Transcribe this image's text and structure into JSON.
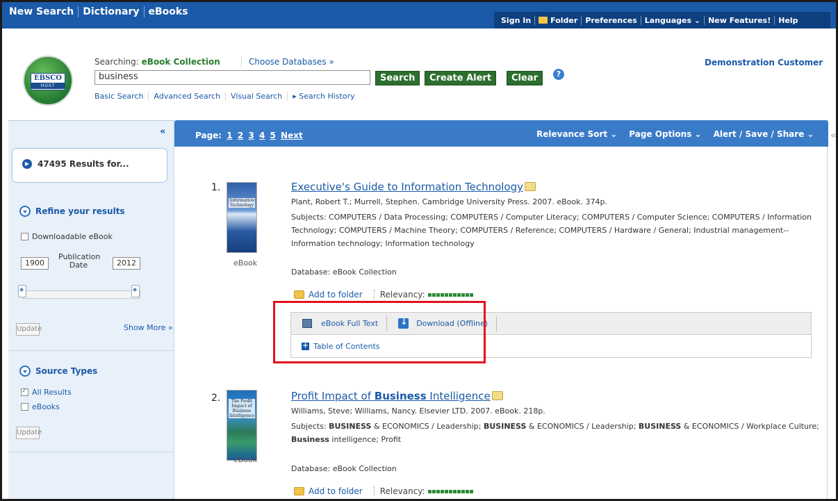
{
  "topnav": {
    "items": [
      "New Search",
      "Dictionary",
      "eBooks"
    ]
  },
  "rightnav": {
    "items": [
      "Sign In",
      "Folder",
      "Preferences",
      "Languages ⌄",
      "New Features!",
      "Help"
    ]
  },
  "search": {
    "searching_label": "Searching:",
    "collection": "eBook Collection",
    "choose_databases": "Choose Databases »",
    "query": "business",
    "buttons": {
      "search": "Search",
      "create_alert": "Create Alert",
      "clear": "Clear"
    },
    "links": [
      "Basic Search",
      "Advanced Search",
      "Visual Search",
      "▸ Search History"
    ]
  },
  "logo": {
    "line1": "EBSCO",
    "line2": "HOST"
  },
  "customer": "Demonstration Customer",
  "sidebar": {
    "collapse": "«",
    "results_count": "47495 Results for...",
    "refine_title": "Refine your results",
    "downloadable": "Downloadable eBook",
    "year_from": "1900",
    "year_to": "2012",
    "pub_date_label": "Publication Date",
    "update": "Update",
    "show_more": "Show More »",
    "source_types_title": "Source Types",
    "source_all": "All Results",
    "source_ebooks": "eBooks",
    "update2": "Update"
  },
  "toolbar": {
    "page_label": "Page:",
    "pages": [
      "1",
      "2",
      "3",
      "4",
      "5",
      "Next"
    ],
    "relevance": "Relevance Sort ⌄",
    "page_options": "Page Options ⌄",
    "alert_share": "Alert / Save / Share ⌄",
    "collapse_right": "«"
  },
  "results": [
    {
      "num": "1.",
      "cover_title": "Information Technology",
      "cover_label": "eBook",
      "title": "Executive's Guide to Information Technology",
      "meta": "Plant, Robert T.; Murrell, Stephen. Cambridge University Press. 2007. eBook. 374p.",
      "subjects": "Subjects: COMPUTERS / Data Processing; COMPUTERS / Computer Literacy; COMPUTERS / Computer Science; COMPUTERS / Information Technology; COMPUTERS / Machine Theory; COMPUTERS / Reference; COMPUTERS / Hardware / General; Industrial management--Information technology; Information technology",
      "database": "Database: eBook Collection",
      "add_folder": "Add to folder",
      "relevancy": "Relevancy:",
      "relevancy_score": 10,
      "full_text": "eBook Full Text",
      "download": "Download (Offline)",
      "toc": "Table of Contents"
    },
    {
      "num": "2.",
      "cover_title": "The Profit Impact of Business Intelligence",
      "cover_label": "eBook",
      "title_pre": "Profit Impact of ",
      "title_bold": "Business",
      "title_post": " Intelligence",
      "meta": "Williams, Steve; Williams, Nancy. Elsevier LTD. 2007. eBook. 218p.",
      "subjects_parts": [
        "Subjects: ",
        "BUSINESS",
        " & ECONOMICS / Leadership; ",
        "BUSINESS",
        " & ECONOMICS / Leadership; ",
        "BUSINESS",
        " & ECONOMICS / Workplace Culture; ",
        "Business",
        " intelligence; Profit"
      ],
      "database": "Database: eBook Collection",
      "add_folder": "Add to folder",
      "relevancy": "Relevancy:",
      "relevancy_score": 10
    }
  ],
  "colors": {
    "topbar": "#1a5aa8",
    "button_green": "#2c6f2e",
    "highlight_red": "#e3101e"
  }
}
